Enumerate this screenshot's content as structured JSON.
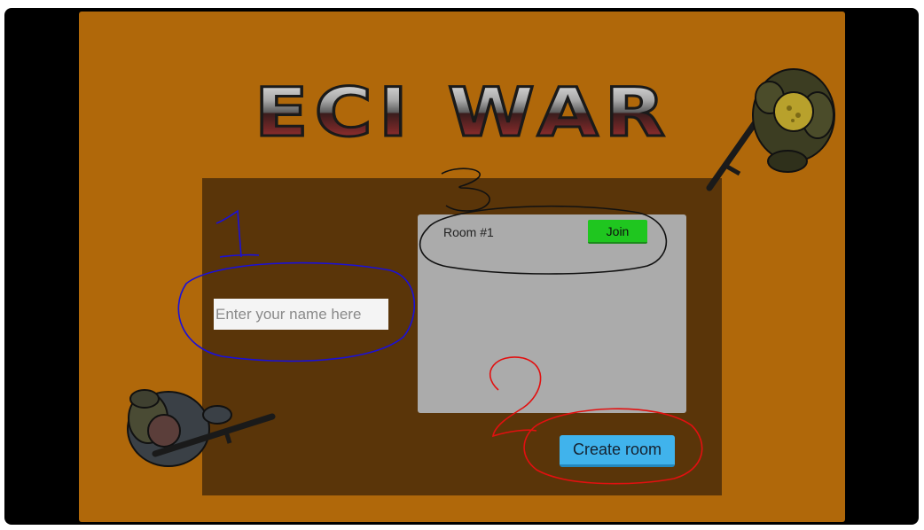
{
  "game": {
    "title": "ECI WAR"
  },
  "lobby": {
    "name_placeholder": "Enter your name here",
    "name_value": "",
    "rooms": [
      {
        "label": "Room #1",
        "join_label": "Join"
      }
    ],
    "create_room_label": "Create room"
  },
  "annotations": {
    "name_marker": "1",
    "create_marker": "2",
    "rooms_marker": "3"
  },
  "colors": {
    "frame": "#000000",
    "background": "#b0680a",
    "panel": "#5a3509",
    "room_list": "#ababab",
    "join_button": "#1fc61f",
    "create_button": "#40b3ec",
    "annot_blue": "#1a10d8",
    "annot_red": "#e21010",
    "annot_black": "#111111"
  }
}
